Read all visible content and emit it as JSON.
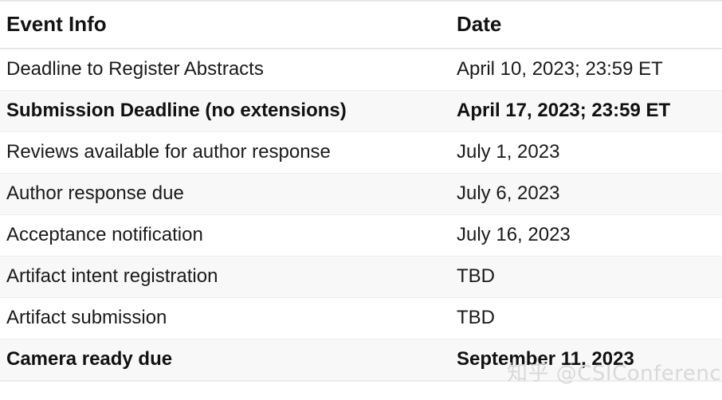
{
  "table": {
    "columns": [
      {
        "key": "event",
        "label": "Event Info"
      },
      {
        "key": "date",
        "label": "Date"
      }
    ],
    "rows": [
      {
        "event": "Deadline to Register Abstracts",
        "date": "April 10, 2023; 23:59 ET",
        "bold": false,
        "striped": false
      },
      {
        "event": "Submission Deadline (no extensions)",
        "date": "April 17, 2023; 23:59 ET",
        "bold": true,
        "striped": true
      },
      {
        "event": "Reviews available for author response",
        "date": "July 1, 2023",
        "bold": false,
        "striped": false
      },
      {
        "event": "Author response due",
        "date": "July 6, 2023",
        "bold": false,
        "striped": true
      },
      {
        "event": "Acceptance notification",
        "date": "July 16, 2023",
        "bold": false,
        "striped": false
      },
      {
        "event": "Artifact intent registration",
        "date": "TBD",
        "bold": false,
        "striped": true
      },
      {
        "event": "Artifact submission",
        "date": "TBD",
        "bold": false,
        "striped": false
      },
      {
        "event": "Camera ready due",
        "date": "September 11, 2023",
        "bold": true,
        "striped": true
      }
    ]
  },
  "watermark": {
    "text": "知乎 @CSIConference"
  },
  "colors": {
    "text": "#1a1a1a",
    "header_text": "#121212",
    "row_stripe": "#f8f8f8",
    "border": "#ececec",
    "watermark": "#d9d9d9",
    "background": "#ffffff"
  }
}
